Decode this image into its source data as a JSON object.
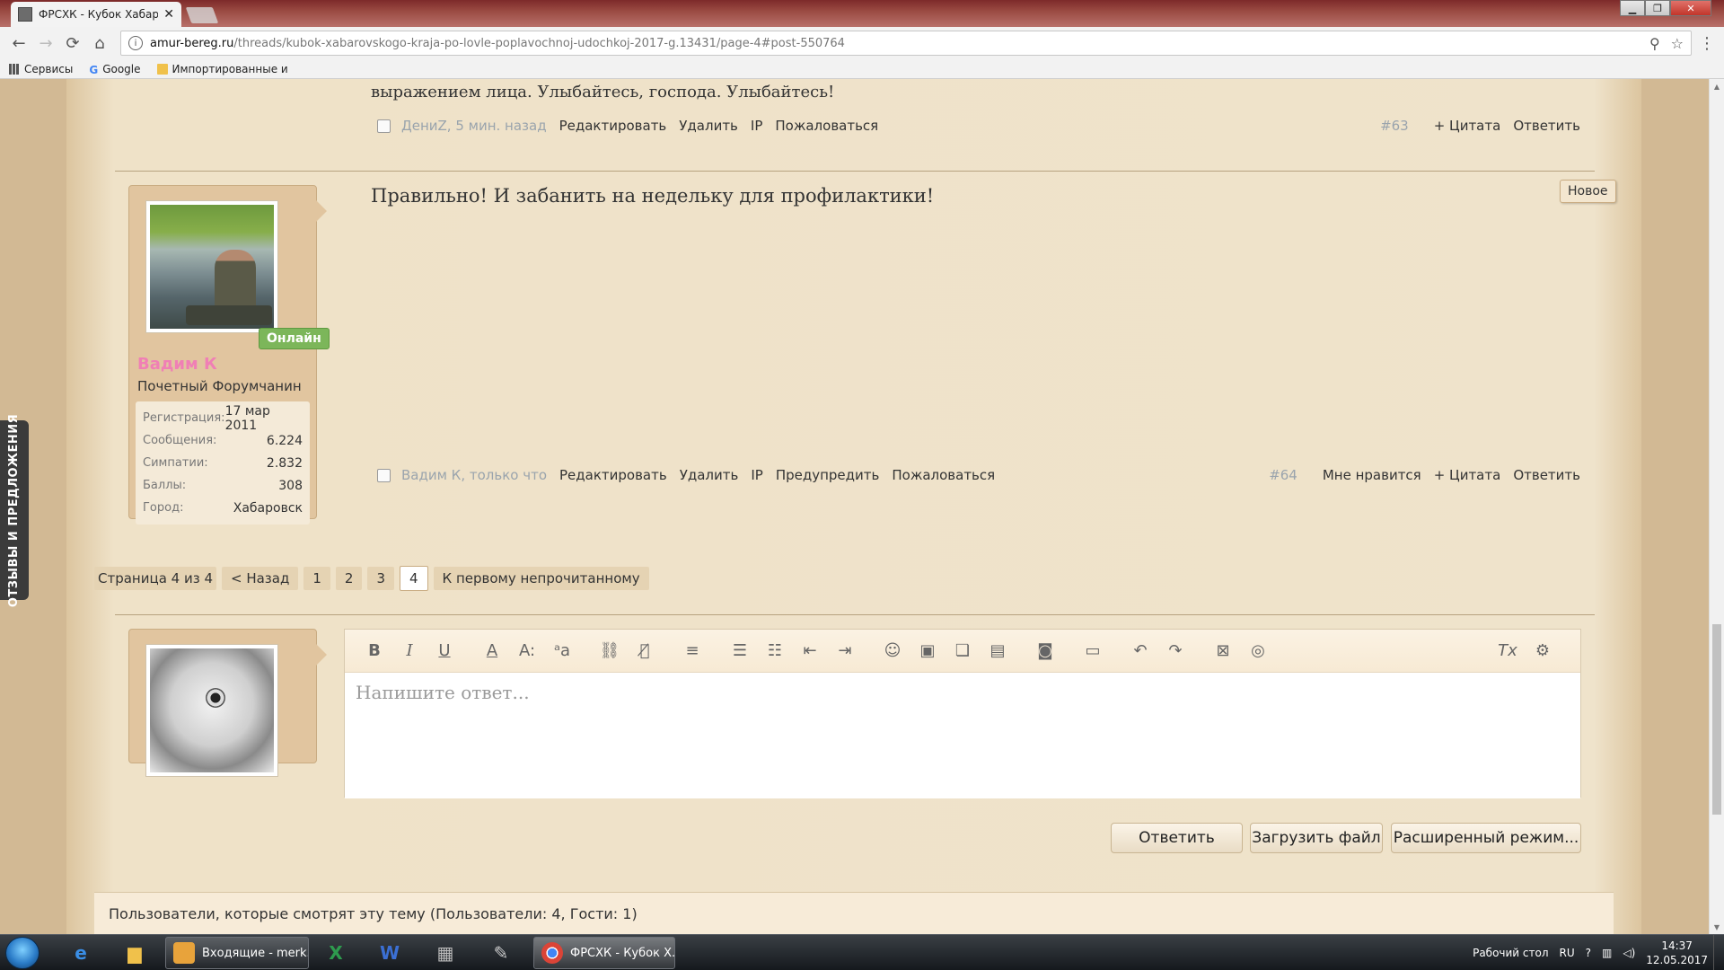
{
  "browser": {
    "tab_title": "ФРСХК - Кубок Хабаров",
    "tab_close": "✕",
    "url_host": "amur-bereg.ru",
    "url_path": "/threads/kubok-xabarovskogo-kraja-po-lovle-poplavochnoj-udochkoj-2017-g.13431/page-4#post-550764",
    "bookmarks": [
      {
        "label": "Сервисы"
      },
      {
        "label": "Google"
      },
      {
        "label": "Импортированные и"
      }
    ]
  },
  "feedback_tab": "ОТЗЫВЫ И ПРЕДЛОЖЕНИЯ",
  "prev_post": {
    "text_tail": "выражением лица. Улыбайтесь, господа. Улыбайтесь!",
    "author_time": "ДениZ, 5 мин. назад",
    "actions": [
      "Редактировать",
      "Удалить",
      "IP",
      "Пожаловаться"
    ],
    "number": "#63",
    "right_actions": [
      "+ Цитата",
      "Ответить"
    ]
  },
  "post": {
    "text": "Правильно! И забанить на недельку для профилактики!",
    "new_badge": "Новое",
    "author_time": "Вадим К, только что",
    "actions": [
      "Редактировать",
      "Удалить",
      "IP",
      "Предупредить",
      "Пожаловаться"
    ],
    "number": "#64",
    "right_actions": [
      "Мне нравится",
      "+ Цитата",
      "Ответить"
    ],
    "user": {
      "online": "Онлайн",
      "name": "Вадим К",
      "title": "Почетный Форумчанин",
      "stats": [
        {
          "key": "Регистрация:",
          "value": "17 мар 2011"
        },
        {
          "key": "Сообщения:",
          "value": "6.224"
        },
        {
          "key": "Симпатии:",
          "value": "2.832"
        },
        {
          "key": "Баллы:",
          "value": "308"
        },
        {
          "key": "Город:",
          "value": "Хабаровск"
        }
      ]
    }
  },
  "pagination": {
    "label": "Страница 4 из 4",
    "prev": "< Назад",
    "pages": [
      "1",
      "2",
      "3",
      "4"
    ],
    "current": "4",
    "first_unread": "К первому непрочитанному"
  },
  "editor": {
    "placeholder": "Напишите ответ...",
    "toolbar": {
      "bold": "B",
      "italic": "I",
      "underline": "U",
      "font_color": "A",
      "font_size": "A:",
      "font_family": "ᵃa"
    }
  },
  "buttons": {
    "reply": "Ответить",
    "upload": "Загрузить файл",
    "advanced": "Расширенный режим..."
  },
  "watchers": "Пользователи, которые смотрят эту тему (Пользователи: 4, Гости: 1)",
  "taskbar": {
    "outlook": "Входящие - merk...",
    "chrome": "ФРСХК - Кубок Х...",
    "desktop": "Рабочий стол",
    "lang": "RU",
    "time": "14:37",
    "date": "12.05.2017"
  }
}
